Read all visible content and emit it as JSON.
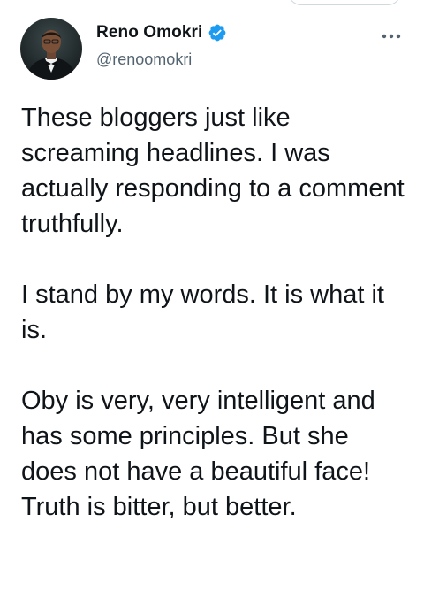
{
  "author": {
    "display_name": "Reno Omokri",
    "handle": "@renoomokri",
    "verified": true,
    "avatar_icon": "profile-photo"
  },
  "actions": {
    "more_icon": "more-horizontal-icon"
  },
  "tweet": {
    "paragraphs": [
      "These bloggers just like screaming headlines. I was actually responding to a comment truthfully.",
      "I stand by my words. It is what it is.",
      "Oby is very, very intelligent and has some principles. But she does not have a beautiful face! Truth is bitter, but better."
    ]
  },
  "colors": {
    "text_primary": "#0f1419",
    "text_secondary": "#536471",
    "verified_blue": "#1d9bf0"
  }
}
